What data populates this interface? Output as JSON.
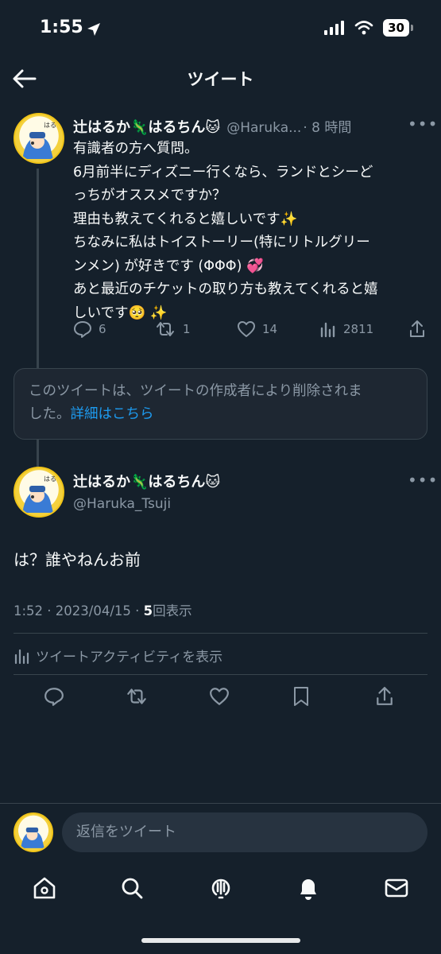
{
  "status_bar": {
    "time": "1:55",
    "battery": "30"
  },
  "header": {
    "title": "ツイート"
  },
  "original_tweet": {
    "display_name": "辻はるか🦎はるちん🐱",
    "handle": "@Haruka...",
    "time": "· 8 時間",
    "lines": [
      "有識者の方へ質問。",
      "6月前半にディズニー行くなら、ランドとシーど",
      "っちがオススメですか？",
      "理由も教えてくれると嬉しいです✨",
      "ちなみに私はトイストーリー(特にリトルグリー",
      "ンメン) が好きです (ΦΦΦ) 💞",
      "あと最近のチケットの取り方も教えてくれると嬉",
      "しいです🥺 ✨"
    ],
    "replies": "6",
    "retweets": "1",
    "likes": "14",
    "views": "2811"
  },
  "deleted_notice": {
    "line1": "このツイートは、ツイートの作成者により削除されま",
    "line2_prefix": "した。",
    "link": "詳細はこちら"
  },
  "main_tweet": {
    "display_name": "辻はるか🦎はるちん🐱",
    "handle": "@Haruka_Tsuji",
    "text": "は？誰やねんお前",
    "time_date": "1:52 · 2023/04/15 · ",
    "views_count": "5",
    "views_label": "回表示",
    "activity_label": "ツイートアクティビティを表示"
  },
  "reply": {
    "placeholder": "返信をツイート"
  },
  "colors": {
    "background": "#15202b",
    "accent": "#1d9bf0",
    "muted": "#8b98a5",
    "border": "#38444d"
  }
}
